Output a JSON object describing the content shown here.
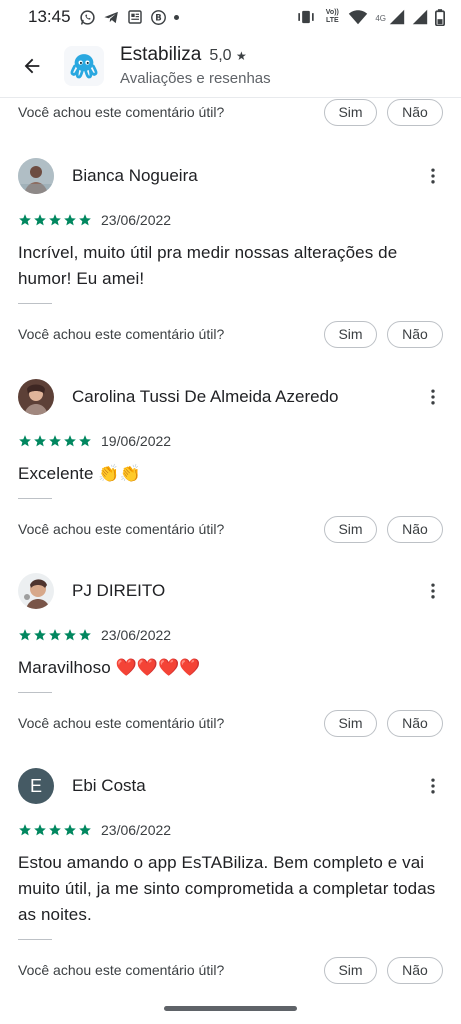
{
  "status_bar": {
    "time": "13:45",
    "volte_label": "Vo)) LTE",
    "network_label": "4G"
  },
  "header": {
    "app_name": "Estabiliza",
    "rating": "5,0",
    "subtitle": "Avaliações e resenhas"
  },
  "helpful": {
    "question": "Você achou este comentário útil?",
    "yes": "Sim",
    "no": "Não"
  },
  "reviews": [
    {
      "name": "Bianca Nogueira",
      "stars": 5,
      "date": "23/06/2022",
      "text": "Incrível, muito útil pra medir nossas alterações de humor! Eu amei!"
    },
    {
      "name": "Carolina Tussi De Almeida Azeredo",
      "stars": 5,
      "date": "19/06/2022",
      "text": "Excelente 👏👏"
    },
    {
      "name": "PJ DIREITO",
      "stars": 5,
      "date": "23/06/2022",
      "text": "Maravilhoso ❤️❤️❤️❤️"
    },
    {
      "name": "Ebi Costa",
      "avatar_letter": "E",
      "stars": 5,
      "date": "23/06/2022",
      "text": "Estou amando o app EsTABiliza. Bem completo e vai muito útil, ja me sinto comprometida a completar todas as noites."
    }
  ],
  "colors": {
    "star": "#01875f",
    "avatar_letter_bg": "#455a64",
    "app_icon": "#2aa8e0"
  },
  "icons": [
    "back-arrow-icon",
    "more-vert-icon",
    "star-icon",
    "wifi-icon",
    "signal-icon",
    "battery-icon",
    "vibrate-icon",
    "whatsapp-icon",
    "telegram-icon",
    "news-icon",
    "b-icon"
  ]
}
